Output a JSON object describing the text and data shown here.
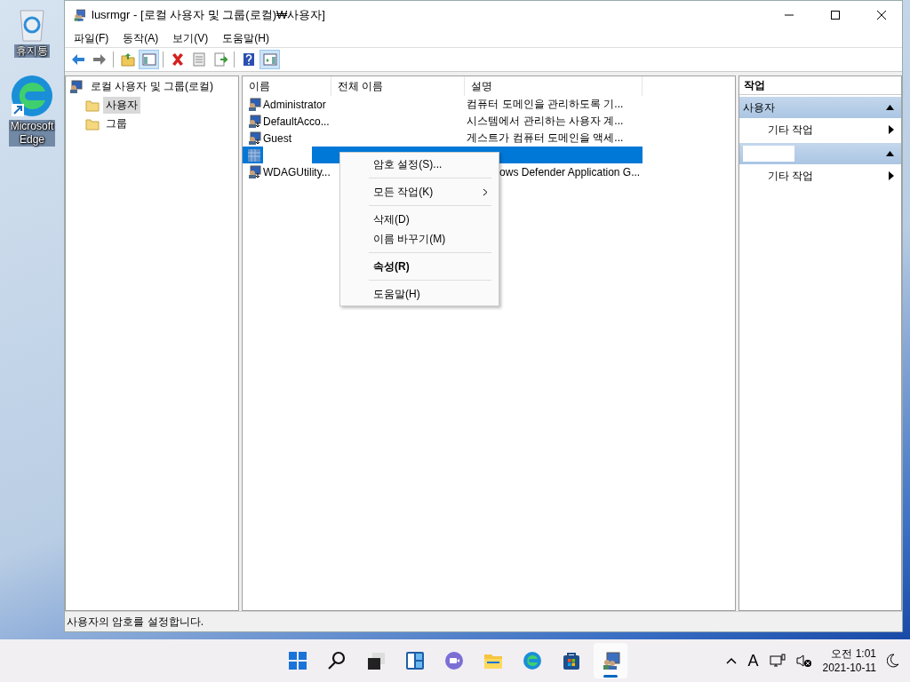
{
  "desktop_icons": [
    {
      "label": "휴지통",
      "kind": "recycle"
    },
    {
      "label": "Microsoft\nEdge",
      "kind": "edge"
    }
  ],
  "window": {
    "title": "lusrmgr - [로컬 사용자 및 그룹(로컬)₩사용자]"
  },
  "menu_bar": [
    "파일(F)",
    "동작(A)",
    "보기(V)",
    "도움말(H)"
  ],
  "toolbar": [
    {
      "kind": "back",
      "on": false
    },
    {
      "kind": "forward",
      "on": false
    },
    {
      "kind": "separator"
    },
    {
      "kind": "up",
      "on": false
    },
    {
      "kind": "tree",
      "on": true
    },
    {
      "kind": "separator"
    },
    {
      "kind": "delete",
      "on": false
    },
    {
      "kind": "properties",
      "on": false
    },
    {
      "kind": "export",
      "on": false
    },
    {
      "kind": "separator"
    },
    {
      "kind": "help",
      "on": false
    },
    {
      "kind": "pane",
      "on": true
    }
  ],
  "tree": {
    "label": "로컬 사용자 및 그룹(로컬)",
    "children": [
      {
        "label": "사용자",
        "selected": true
      },
      {
        "label": "그룹",
        "selected": false
      }
    ]
  },
  "table": {
    "columns": [
      "이름",
      "전체 이름",
      "설명"
    ],
    "rows": [
      {
        "name": "Administrator",
        "description": "컴퓨터 도메인을 관리하도록 기...",
        "kind": "admin",
        "selected": false,
        "name_hidden": false,
        "description_clipped": false
      },
      {
        "name": "DefaultAcco...",
        "description": "시스템에서 관리하는 사용자 계...",
        "kind": "disabled",
        "selected": false,
        "name_hidden": false,
        "description_clipped": false
      },
      {
        "name": "Guest",
        "description": "게스트가 컴퓨터 도메인을 액세...",
        "kind": "disabled",
        "selected": false,
        "name_hidden": false,
        "description_clipped": false
      },
      {
        "kind": "user",
        "selected": true,
        "name_hidden": true
      },
      {
        "name": "WDAGUtility...",
        "description": "ows Defender Application G...",
        "kind": "disabled",
        "selected": false,
        "name_hidden": false,
        "description_clipped": true
      }
    ]
  },
  "context_menu": [
    {
      "kind": "item",
      "label": "암호 설정(S)...",
      "default": false,
      "submenu": false
    },
    {
      "kind": "separator"
    },
    {
      "kind": "item",
      "label": "모든 작업(K)",
      "default": false,
      "submenu": true
    },
    {
      "kind": "separator"
    },
    {
      "kind": "item",
      "label": "삭제(D)",
      "default": false,
      "submenu": false
    },
    {
      "kind": "item",
      "label": "이름 바꾸기(M)",
      "default": false,
      "submenu": false
    },
    {
      "kind": "separator"
    },
    {
      "kind": "item",
      "label": "속성(R)",
      "default": true,
      "submenu": false
    },
    {
      "kind": "separator"
    },
    {
      "kind": "item",
      "label": "도움말(H)",
      "default": false,
      "submenu": false
    }
  ],
  "actions": {
    "title": "작업",
    "sections": [
      {
        "title": "사용자",
        "title_hidden": false,
        "expanded": true,
        "items": [
          "기타 작업"
        ]
      },
      {
        "title_hidden": true,
        "expanded": true,
        "items": [
          "기타 작업"
        ]
      }
    ]
  },
  "status_bar": "사용자의 암호를 설정합니다.",
  "taskbar": {
    "apps": [
      {
        "kind": "start",
        "selected": false
      },
      {
        "kind": "search",
        "selected": false
      },
      {
        "kind": "taskview",
        "selected": false
      },
      {
        "kind": "widgets",
        "selected": false
      },
      {
        "kind": "chat",
        "selected": false
      },
      {
        "kind": "explorer",
        "selected": false
      },
      {
        "kind": "edge",
        "selected": false
      },
      {
        "kind": "store",
        "selected": false
      },
      {
        "kind": "lusrmgr",
        "selected": true
      }
    ],
    "input_indicator": "A",
    "time": "오전 1:01",
    "date": "2021-10-11"
  }
}
